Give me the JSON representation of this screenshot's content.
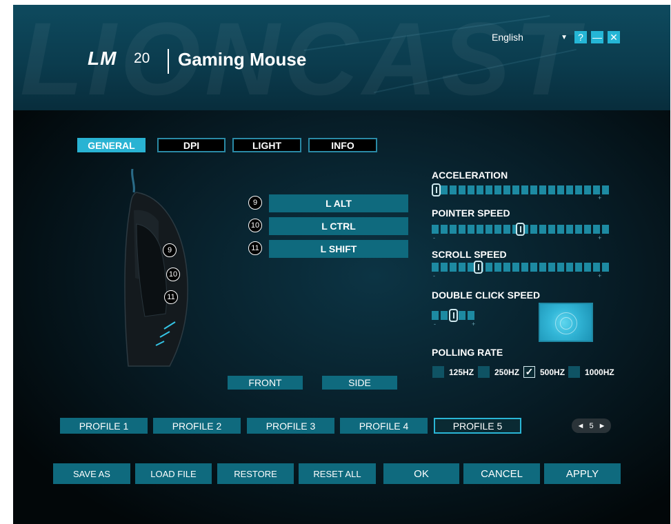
{
  "header": {
    "brand": "LM",
    "model": "20",
    "title": "Gaming Mouse",
    "watermark": "LIONCAST",
    "language": "English"
  },
  "window_controls": [
    {
      "name": "help",
      "label": "?"
    },
    {
      "name": "minimize",
      "label": "—"
    },
    {
      "name": "close",
      "label": "✕"
    }
  ],
  "tabs": [
    {
      "label": "GENERAL",
      "active": true
    },
    {
      "label": "DPI",
      "active": false
    },
    {
      "label": "LIGHT",
      "active": false
    },
    {
      "label": "INFO",
      "active": false
    }
  ],
  "mouse_buttons": [
    {
      "number": "9",
      "assignment": "L ALT"
    },
    {
      "number": "10",
      "assignment": "L CTRL"
    },
    {
      "number": "11",
      "assignment": "L SHIFT"
    }
  ],
  "views": {
    "front": "FRONT",
    "side": "SIDE"
  },
  "sliders": {
    "acceleration": {
      "label": "ACCELERATION",
      "level": 0.0,
      "segments": 20
    },
    "pointer_speed": {
      "label": "POINTER SPEED",
      "level": 0.5,
      "segments": 20
    },
    "scroll_speed": {
      "label": "SCROLL SPEED",
      "level": 0.25,
      "segments": 20
    },
    "double_click_speed": {
      "label": "DOUBLE CLICK SPEED",
      "level": 0.5,
      "segments": 5
    }
  },
  "slider_marks": {
    "minus": "-",
    "plus": "+"
  },
  "polling_rate": {
    "label": "POLLING RATE",
    "options": [
      {
        "label": "125HZ",
        "checked": false
      },
      {
        "label": "250HZ",
        "checked": false
      },
      {
        "label": "500HZ",
        "checked": true
      },
      {
        "label": "1000HZ",
        "checked": false
      }
    ]
  },
  "profiles": [
    {
      "label": "PROFILE 1",
      "active": false
    },
    {
      "label": "PROFILE 2",
      "active": false
    },
    {
      "label": "PROFILE 3",
      "active": false
    },
    {
      "label": "PROFILE 4",
      "active": false
    },
    {
      "label": "PROFILE 5",
      "active": true
    }
  ],
  "pager": {
    "prev": "◄",
    "value": "5",
    "next": "►"
  },
  "actions": {
    "save_as": "SAVE AS",
    "load_file": "LOAD FILE",
    "restore": "RESTORE",
    "reset_all": "RESET ALL",
    "ok": "OK",
    "cancel": "CANCEL",
    "apply": "APPLY"
  },
  "colors": {
    "accent": "#29b3d3",
    "button": "#0f6a7e",
    "background": "#000000"
  }
}
